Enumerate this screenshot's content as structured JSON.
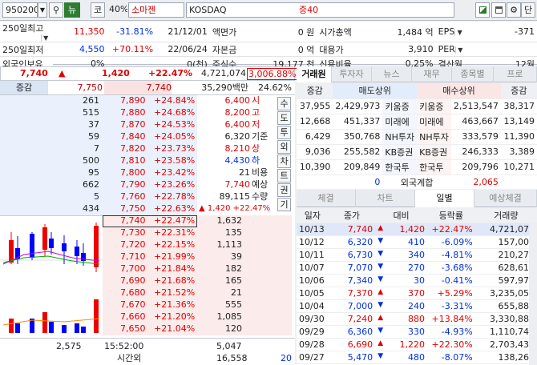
{
  "toolbar": {
    "code": "950200",
    "market_btn": "뉴",
    "type_btn": "코",
    "margin": "40%",
    "name": "소마젠",
    "market": "KOSDAQ",
    "deposit": "증40",
    "save_btn": "단"
  },
  "info": {
    "rows": [
      [
        "250일최고",
        "11,350",
        "-31.81%",
        "21/12/01",
        "액면가",
        "0 원",
        "시가총액",
        "1,484 억",
        "EPS",
        "-371"
      ],
      [
        "250일최저",
        "4,550",
        "+70.11%",
        "22/06/24",
        "자본금",
        "0 억",
        "대용가",
        "3,910",
        "PER",
        ""
      ],
      [
        "외국인보유",
        "0%",
        "",
        "0(천)",
        "주식수",
        "19,177 천",
        "신용비율",
        "0.25%",
        "결산월",
        "12월"
      ]
    ]
  },
  "price": {
    "current": "7,740",
    "arrow": "▲",
    "change": "1,420",
    "rate": "+22.47%",
    "volume": "4,721,074",
    "vol_rate": "3,006.88%"
  },
  "col_head": {
    "label": "증감",
    "ask": "7,750",
    "bid": "7,740",
    "amount": "35,290백만",
    "ratio": "24.62%"
  },
  "asks": [
    {
      "qty": "261",
      "price": "7,890",
      "rate": "+24.84%"
    },
    {
      "qty": "515",
      "price": "7,880",
      "rate": "+24.68%"
    },
    {
      "qty": "37",
      "price": "7,870",
      "rate": "+24.53%"
    },
    {
      "qty": "59",
      "price": "7,840",
      "rate": "+24.05%"
    },
    {
      "qty": "7",
      "price": "7,820",
      "rate": "+23.73%"
    },
    {
      "qty": "500",
      "price": "7,810",
      "rate": "+23.58%"
    },
    {
      "qty": "95",
      "price": "7,800",
      "rate": "+23.42%"
    },
    {
      "qty": "662",
      "price": "7,790",
      "rate": "+23.26%"
    },
    {
      "qty": "5",
      "price": "7,760",
      "rate": "+22.78%"
    },
    {
      "qty": "434",
      "price": "7,750",
      "rate": "+22.63%"
    }
  ],
  "bids": [
    {
      "qty": "1,632",
      "price": "7,740",
      "rate": "+22.47%"
    },
    {
      "qty": "135",
      "price": "7,730",
      "rate": "+22.31%"
    },
    {
      "qty": "1,113",
      "price": "7,720",
      "rate": "+22.15%"
    },
    {
      "qty": "39",
      "price": "7,710",
      "rate": "+21.99%"
    },
    {
      "qty": "182",
      "price": "7,700",
      "rate": "+21.84%"
    },
    {
      "qty": "165",
      "price": "7,690",
      "rate": "+21.68%"
    },
    {
      "qty": "21",
      "price": "7,680",
      "rate": "+21.52%"
    },
    {
      "qty": "555",
      "price": "7,670",
      "rate": "+21.36%"
    },
    {
      "qty": "1,085",
      "price": "7,660",
      "rate": "+21.20%"
    },
    {
      "qty": "120",
      "price": "7,650",
      "rate": "+21.04%"
    }
  ],
  "summary": [
    {
      "price": "6,400",
      "label": "시"
    },
    {
      "price": "8,200",
      "label": "고"
    },
    {
      "price": "6,400",
      "label": "저"
    },
    {
      "price": "6,320",
      "label": "기준"
    },
    {
      "price": "8,210",
      "label": "상"
    },
    {
      "price": "4,430",
      "label": "하"
    },
    {
      "price": "21",
      "label": "비용"
    },
    {
      "price": "7,740",
      "label": "예상"
    },
    {
      "price": "89,115",
      "label": "수량"
    },
    {
      "price": "▲ 1,420 +22.47%",
      "label": ""
    }
  ],
  "side_buttons": [
    "수",
    "도",
    "투",
    "외",
    "차",
    "트",
    "권",
    "기"
  ],
  "footer": {
    "ask_total": "2,575",
    "time": "15:52:00",
    "bid_total": "5,047",
    "after_label": "시간외",
    "after_qty": "16,558",
    "after_right": "20"
  },
  "tabs1": [
    "거래원",
    "투자자",
    "뉴스",
    "재무",
    "종목별",
    "프로"
  ],
  "broker": {
    "headers": [
      "증감",
      "매도상위",
      "",
      "매수상위",
      "증감"
    ],
    "rows": [
      [
        "37,955",
        "2,429,973",
        "키움증",
        "키움증",
        "2,513,547",
        "38,317"
      ],
      [
        "12,668",
        "451,337",
        "미래에",
        "미래에",
        "463,667",
        "13,149"
      ],
      [
        "6,429",
        "350,768",
        "NH투자",
        "NH투자",
        "333,579",
        "11,390"
      ],
      [
        "9,036",
        "255,582",
        "KB증권",
        "KB증권",
        "246,333",
        "3,389"
      ],
      [
        "10,390",
        "209,849",
        "한국투",
        "한국투",
        "209,796",
        "10,271"
      ]
    ],
    "foreign": [
      "0",
      "외국계합",
      "2,065"
    ]
  },
  "tabs2": [
    "체결",
    "차트",
    "일별",
    "예상체결"
  ],
  "daily": {
    "headers": [
      "일자",
      "종가",
      "대비",
      "등락률",
      "거래량"
    ],
    "rows": [
      [
        "10/13",
        "7,740",
        "▲",
        "1,420",
        "+22.47%",
        "4,721,074"
      ],
      [
        "10/12",
        "6,320",
        "▼",
        "410",
        "-6.09%",
        "157,009"
      ],
      [
        "10/11",
        "6,730",
        "▼",
        "340",
        "-4.81%",
        "210,274"
      ],
      [
        "10/07",
        "7,070",
        "▼",
        "270",
        "-3.68%",
        "628,619"
      ],
      [
        "10/06",
        "7,340",
        "▼",
        "30",
        "-0.41%",
        "597,972"
      ],
      [
        "10/05",
        "7,370",
        "▲",
        "370",
        "+5.29%",
        "3,235,051"
      ],
      [
        "10/04",
        "7,000",
        "▼",
        "240",
        "-3.31%",
        "655,880"
      ],
      [
        "09/30",
        "7,240",
        "▲",
        "880",
        "+13.84%",
        "3,330,883"
      ],
      [
        "09/29",
        "6,360",
        "▼",
        "330",
        "-4.93%",
        "1,110,749"
      ],
      [
        "09/28",
        "6,690",
        "▲",
        "1,220",
        "+22.30%",
        "2,703,432"
      ],
      [
        "09/27",
        "5,470",
        "▼",
        "480",
        "-8.07%",
        "138,260"
      ]
    ]
  },
  "colors": {
    "up": "#e00000",
    "down": "#0030e0",
    "ask_bg": "#e8f0fc",
    "bid_bg": "#fcecec"
  }
}
